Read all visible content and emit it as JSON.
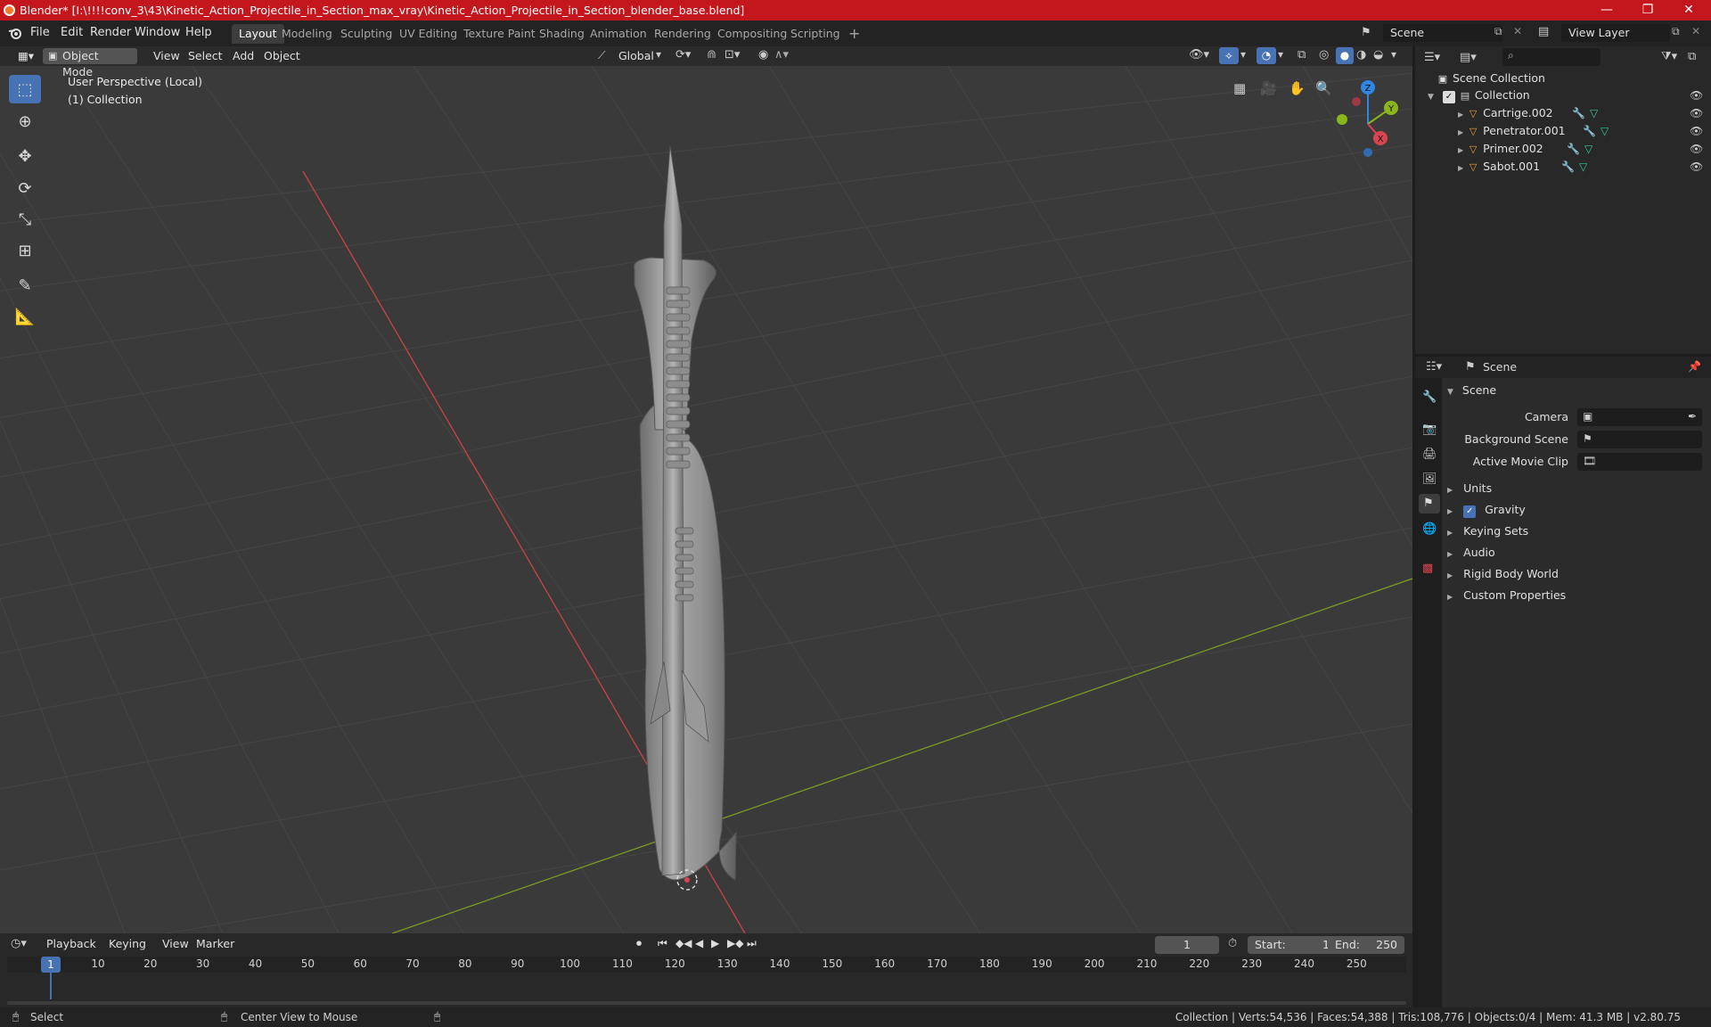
{
  "window": {
    "title": "Blender* [I:\\!!!!conv_3\\43\\Kinetic_Action_Projectile_in_Section_max_vray\\Kinetic_Action_Projectile_in_Section_blender_base.blend]",
    "minimize": "—",
    "maximize": "❐",
    "close": "✕"
  },
  "menus": [
    "File",
    "Edit",
    "Render",
    "Window",
    "Help"
  ],
  "workspaces": [
    {
      "label": "Layout",
      "active": true
    },
    {
      "label": "Modeling"
    },
    {
      "label": "Sculpting"
    },
    {
      "label": "UV Editing"
    },
    {
      "label": "Texture Paint"
    },
    {
      "label": "Shading"
    },
    {
      "label": "Animation"
    },
    {
      "label": "Rendering"
    },
    {
      "label": "Compositing"
    },
    {
      "label": "Scripting"
    }
  ],
  "add_workspace": "+",
  "scene_selector": "Scene",
  "view_layer_selector": "View Layer",
  "viewport": {
    "mode": "Object Mode",
    "menus": [
      "View",
      "Select",
      "Add",
      "Object"
    ],
    "transform_orientation": "Global",
    "perspective_label": "User Perspective (Local)",
    "collection_label": "(1) Collection",
    "gizmo": {
      "x": "X",
      "y": "Y",
      "z": "Z"
    }
  },
  "outliner": {
    "search_placeholder": "",
    "root": "Scene Collection",
    "collection": "Collection",
    "objects": [
      "Cartrige.002",
      "Penetrator.001",
      "Primer.002",
      "Sabot.001"
    ]
  },
  "properties": {
    "header": "Scene",
    "section": "Scene",
    "fields": [
      {
        "label": "Camera",
        "value": ""
      },
      {
        "label": "Background Scene",
        "value": ""
      },
      {
        "label": "Active Movie Clip",
        "value": ""
      }
    ],
    "panels": [
      "Units",
      "Gravity",
      "Keying Sets",
      "Audio",
      "Rigid Body World",
      "Custom Properties"
    ]
  },
  "timeline": {
    "menus": [
      "Playback",
      "Keying",
      "View",
      "Marker"
    ],
    "current_frame": "1",
    "start_label": "Start:",
    "start": "1",
    "end_label": "End:",
    "end": "250",
    "ticks": [
      "1",
      "10",
      "20",
      "30",
      "40",
      "50",
      "60",
      "70",
      "80",
      "90",
      "100",
      "110",
      "120",
      "130",
      "140",
      "150",
      "160",
      "170",
      "180",
      "190",
      "200",
      "210",
      "220",
      "230",
      "240",
      "250"
    ]
  },
  "status": {
    "left": "Select",
    "middle": "Center View to Mouse",
    "right": "Collection | Verts:54,536 | Faces:54,388 | Tris:108,776 | Objects:0/4 | Mem: 41.3 MB | v2.80.75"
  },
  "colors": {
    "title_bar": "#c4171d",
    "accent": "#4772b3",
    "x_axis": "#d94452",
    "y_axis": "#8ab61d",
    "z_axis": "#2f86e3"
  }
}
